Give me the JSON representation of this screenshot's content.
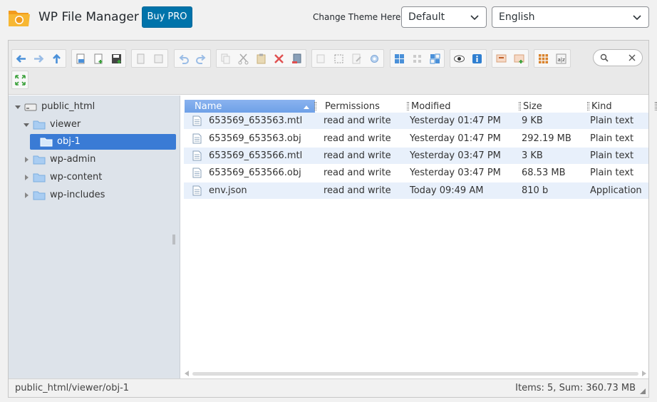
{
  "header": {
    "app_title": "WP File Manager",
    "buy_pro_label": "Buy PRO",
    "theme_label": "Change Theme Here:",
    "theme_value": "Default",
    "language_value": "English",
    "accent_color": "#0073aa",
    "logo_color": "#f29b1d"
  },
  "toolbar": {
    "icons": [
      "back-icon",
      "forward-icon",
      "up-icon",
      "reload-icon",
      "new-file-icon",
      "save-icon",
      "copy-icon",
      "paste-icon",
      "undo-icon",
      "redo-icon",
      "duplicate-icon",
      "cut-icon",
      "clipboard-icon",
      "delete-icon",
      "trash-icon",
      "rename-icon",
      "select-icon",
      "edit-icon",
      "archive-icon",
      "view-grid-icon",
      "view-small-icon",
      "view-list-icon",
      "preview-icon",
      "info-icon",
      "extract-icon",
      "resize-icon",
      "icons-view-icon",
      "sort-icon",
      "fullscreen-icon"
    ],
    "search_placeholder": ""
  },
  "tree": {
    "items": [
      {
        "label": "public_html",
        "level": 0,
        "expanded": true,
        "root": true
      },
      {
        "label": "viewer",
        "level": 1,
        "expanded": true
      },
      {
        "label": "obj-1",
        "level": 2,
        "selected": true
      },
      {
        "label": "wp-admin",
        "level": 1,
        "expanded": false
      },
      {
        "label": "wp-content",
        "level": 1,
        "expanded": false
      },
      {
        "label": "wp-includes",
        "level": 1,
        "expanded": false
      }
    ]
  },
  "table": {
    "columns": [
      "Name",
      "Permissions",
      "Modified",
      "Size",
      "Kind"
    ],
    "rows": [
      {
        "name": "653569_653563.mtl",
        "permissions": "read and write",
        "modified": "Yesterday 01:47 PM",
        "size": "9 KB",
        "kind": "Plain text"
      },
      {
        "name": "653569_653563.obj",
        "permissions": "read and write",
        "modified": "Yesterday 01:47 PM",
        "size": "292.19 MB",
        "kind": "Plain text"
      },
      {
        "name": "653569_653566.mtl",
        "permissions": "read and write",
        "modified": "Yesterday 03:47 PM",
        "size": "3 KB",
        "kind": "Plain text"
      },
      {
        "name": "653569_653566.obj",
        "permissions": "read and write",
        "modified": "Yesterday 03:47 PM",
        "size": "68.53 MB",
        "kind": "Plain text"
      },
      {
        "name": "env.json",
        "permissions": "read and write",
        "modified": "Today 09:49 AM",
        "size": "810 b",
        "kind": "Application"
      }
    ]
  },
  "status": {
    "path": "public_html/viewer/obj-1",
    "summary": "Items: 5, Sum: 360.73 MB"
  }
}
